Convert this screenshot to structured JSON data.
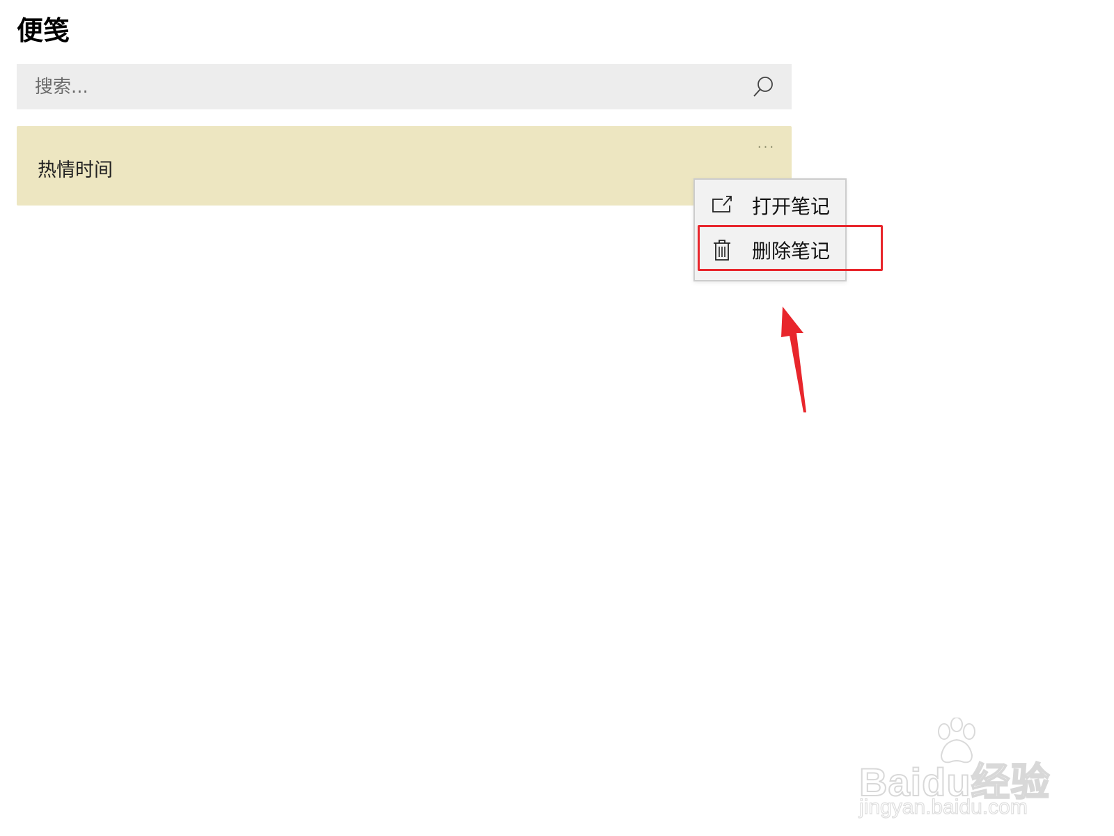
{
  "app": {
    "title": "便笺"
  },
  "search": {
    "placeholder": "搜索..."
  },
  "notes": [
    {
      "text": "热情时间"
    }
  ],
  "note_menu": {
    "more_label": "···",
    "items": [
      {
        "label": "打开笔记",
        "icon": "open-external-icon"
      },
      {
        "label": "删除笔记",
        "icon": "trash-icon"
      }
    ]
  },
  "annotation": {
    "highlight_color": "#e8262c",
    "arrow_color": "#e8262c"
  },
  "watermark": {
    "logo_text": "Baidu经验",
    "url": "jingyan.baidu.com"
  },
  "colors": {
    "note_background": "#ede6c1",
    "search_background": "#ededed",
    "menu_background": "#f2f2f2"
  }
}
